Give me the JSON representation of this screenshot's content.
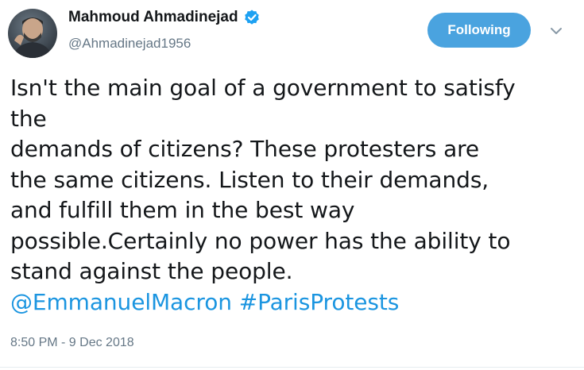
{
  "author": {
    "display_name": "Mahmoud Ahmadinejad",
    "handle": "@Ahmadinejad1956",
    "verified": true
  },
  "follow_button": {
    "label": "Following",
    "color": "#4aa3df"
  },
  "menu_icon": "chevron-down-icon",
  "tweet": {
    "lines": [
      "Isn't the main goal of a government to satisfy",
      "the",
      "demands of  citizens? These protesters are",
      "the same citizens. Listen to their demands,",
      "and fulfill them in the best way",
      "possible.Certainly no power has the ability to",
      "stand against the people."
    ],
    "mention": "@EmmanuelMacron",
    "hashtag": "#ParisProtests",
    "link_color": "#1b95e0"
  },
  "timestamp": "8:50 PM - 9 Dec 2018"
}
